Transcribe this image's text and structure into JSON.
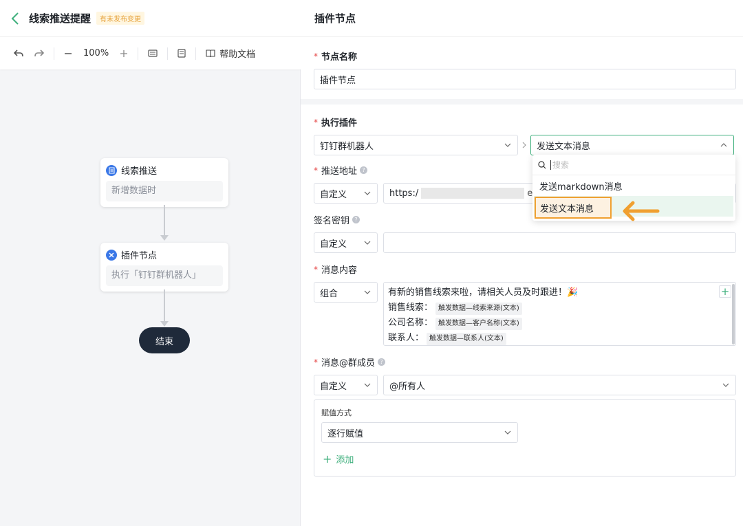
{
  "header": {
    "title": "线索推送提醒",
    "badge": "有未发布变更"
  },
  "toolbar": {
    "zoom": "100%",
    "help": "帮助文档"
  },
  "canvas": {
    "nodes": [
      {
        "title": "线索推送",
        "subtitle": "新增数据时",
        "icon": "document-icon"
      },
      {
        "title": "插件节点",
        "subtitle": "执行「钉钉群机器人」",
        "icon": "plugin-icon"
      }
    ],
    "end_label": "结束"
  },
  "panel": {
    "title": "插件节点",
    "node_name": {
      "label": "节点名称",
      "value": "插件节点"
    },
    "plugin": {
      "label": "执行插件",
      "plugin_value": "钉钉群机器人",
      "action_value": "发送文本消息"
    },
    "dropdown": {
      "search_placeholder": "搜索",
      "options": [
        "发送markdown消息",
        "发送文本消息"
      ],
      "selected": "发送文本消息"
    },
    "push_url": {
      "label": "推送地址",
      "mode": "自定义",
      "value": "https:/",
      "tail": "enc"
    },
    "sign_key": {
      "label": "签名密钥",
      "mode": "自定义",
      "value": ""
    },
    "message": {
      "label": "消息内容",
      "mode": "组合",
      "line1": "有新的销售线索来啦，请相关人员及时跟进！🎉",
      "rows": [
        {
          "key": "销售线索：",
          "chip": "触发数据—线索来源(文本)"
        },
        {
          "key": "公司名称：",
          "chip": "触发数据—客户名称(文本)"
        },
        {
          "key": "联系人：",
          "chip": "触发数据—联系人(文本)"
        }
      ]
    },
    "mention": {
      "label": "消息@群成员",
      "mode": "自定义",
      "value": "@所有人"
    },
    "assign": {
      "label": "赋值方式",
      "value": "逐行赋值",
      "add": "添加"
    }
  },
  "colors": {
    "accent": "#3eaf7c",
    "highlight": "#f0a030",
    "required": "#e54545",
    "end_node": "#1f2a3a"
  }
}
